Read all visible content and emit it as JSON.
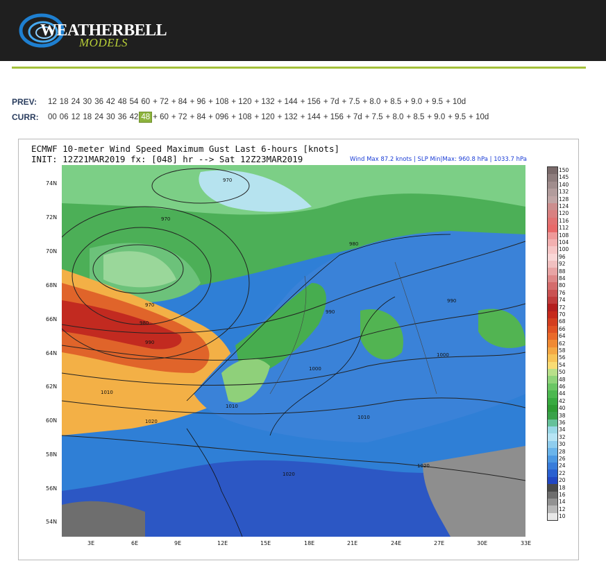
{
  "brand": {
    "logo_text_1": "WEATHERBELL",
    "logo_text_2": "MODELS",
    "accent_color": "#a4c13a",
    "header_color": "#1f1f1f"
  },
  "nav": {
    "prev_label": "PREV:",
    "prev_hours": [
      "12",
      "18",
      "24",
      "30",
      "36",
      "42",
      "48",
      "54",
      "60",
      "+ 72",
      "+ 84",
      "+ 96",
      "+ 108",
      "+ 120",
      "+ 132",
      "+ 144",
      "+ 156",
      "+ 7d",
      "+ 7.5",
      "+ 8.0",
      "+ 8.5",
      "+ 9.0",
      "+ 9.5",
      "+ 10d"
    ],
    "curr_label": "CURR:",
    "curr_hours": [
      "00",
      "06",
      "12",
      "18",
      "24",
      "30",
      "36",
      "42",
      "48",
      "+ 60",
      "+ 72",
      "+ 84",
      "+ 096",
      "+ 108",
      "+ 120",
      "+ 132",
      "+ 144",
      "+ 156",
      "+ 7d",
      "+ 7.5",
      "+ 8.0",
      "+ 8.5",
      "+ 9.0",
      "+ 9.5",
      "+ 10d"
    ],
    "curr_selected": "48"
  },
  "map": {
    "title_line1": "ECMWF 10-meter Wind Speed Maximum Gust Last 6-hours [knots]",
    "title_line2": "INIT: 12Z21MAR2019 fx: [048] hr --> Sat 12Z23MAR2019",
    "stats": "Wind Max 87.2 knots | SLP Min|Max: 960.8 hPa | 1033.7 hPa",
    "lat_labels": [
      "74N",
      "72N",
      "70N",
      "68N",
      "66N",
      "64N",
      "62N",
      "60N",
      "58N",
      "56N",
      "54N"
    ],
    "lon_labels": [
      "3E",
      "6E",
      "9E",
      "12E",
      "15E",
      "18E",
      "21E",
      "24E",
      "27E",
      "30E",
      "33E"
    ],
    "isobar_labels": [
      "970",
      "970",
      "970",
      "980",
      "990",
      "980",
      "990",
      "990",
      "1000",
      "1000",
      "1010",
      "1010",
      "1010",
      "1020",
      "1020",
      "1020"
    ],
    "colorbar_labels": [
      "150",
      "145",
      "140",
      "132",
      "128",
      "124",
      "120",
      "116",
      "112",
      "108",
      "104",
      "100",
      "96",
      "92",
      "88",
      "84",
      "80",
      "76",
      "74",
      "72",
      "70",
      "68",
      "66",
      "64",
      "62",
      "58",
      "56",
      "54",
      "50",
      "48",
      "46",
      "44",
      "42",
      "40",
      "38",
      "36",
      "34",
      "32",
      "30",
      "28",
      "26",
      "24",
      "22",
      "20",
      "18",
      "16",
      "14",
      "12",
      "10"
    ],
    "colorbar_colors": [
      "#7a6a6a",
      "#8e7d7d",
      "#a08d8d",
      "#b29c9c",
      "#c0a5a5",
      "#cc8e8e",
      "#d98080",
      "#e27272",
      "#e86a6a",
      "#ee9a9a",
      "#f2b0b0",
      "#f6c6c6",
      "#f9d6d6",
      "#f1c0c0",
      "#e8a4a4",
      "#de8888",
      "#d46c6c",
      "#ca5252",
      "#c03c3c",
      "#b41f1f",
      "#c62a1c",
      "#d33e1f",
      "#e05224",
      "#ea6a2a",
      "#f08a34",
      "#f4a844",
      "#f7c458",
      "#f9dc74",
      "#b8e08a",
      "#8fd47a",
      "#6ac664",
      "#4cb850",
      "#38aa40",
      "#2e9c34",
      "#3aa24a",
      "#66c19a",
      "#9ad8e6",
      "#b6e4f4",
      "#8fcdee",
      "#6ab4ea",
      "#4c98e2",
      "#387cda",
      "#2a60d0",
      "#2247c2",
      "#4a4a4a",
      "#6e6e6e",
      "#929292",
      "#b8b8b8",
      "#e8e8e8"
    ]
  }
}
